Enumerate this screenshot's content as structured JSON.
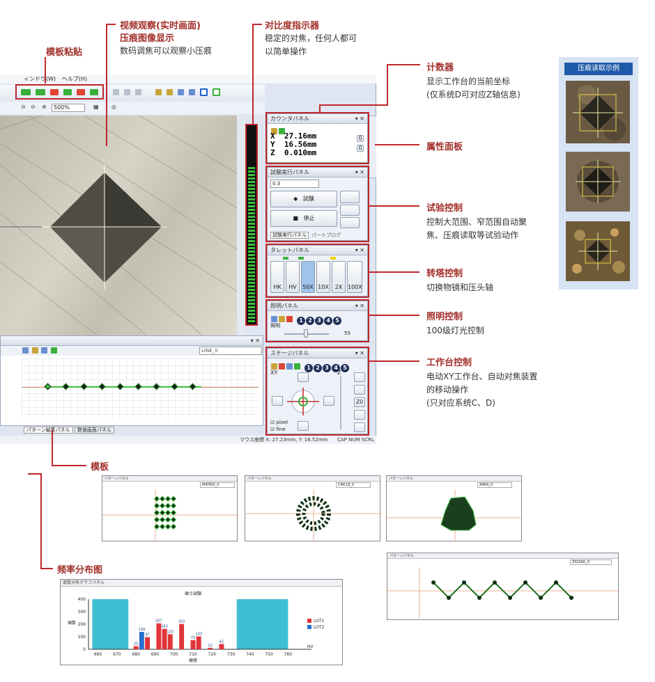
{
  "annotations": {
    "template_paste": {
      "title": "模板粘贴"
    },
    "video": {
      "title": "视频观察(实时画面)",
      "subtitle": "压痕图像显示",
      "desc": "数码调焦可以观察小压痕"
    },
    "contrast": {
      "title": "对比度指示器",
      "desc_l1": "稳定的对焦，任何人都可",
      "desc_l2": "以简单操作"
    },
    "counter": {
      "title": "计数器",
      "desc_l1": "显示工作台的当前坐标",
      "desc_l2": "(仅系统D可对应Z轴信息)"
    },
    "property": {
      "title": "属性面板"
    },
    "test_control": {
      "title": "试验控制",
      "desc_l1": "控制大范围、窄范围自动聚",
      "desc_l2": "焦、压痕读取等试验动作"
    },
    "turret_control": {
      "title": "转塔控制",
      "desc": "切换物镜和压头轴"
    },
    "light_control": {
      "title": "照明控制",
      "desc": "100级灯光控制"
    },
    "stage_control": {
      "title": "工作台控制",
      "desc_l1": "电动XY工作台、自动对焦装置",
      "desc_l2": "的移动操作",
      "desc_l3": "(只对应系统C、D)"
    },
    "template": {
      "title": "模板"
    },
    "freq": {
      "title": "频率分布图"
    }
  },
  "example": {
    "title": "压痕读取示例"
  },
  "menu": {
    "window": "ィンドウ(W)",
    "help": "ヘルプ(H)",
    "zoom": "500%"
  },
  "counter_panel": {
    "title": "カウンタパネル",
    "x_label": "X",
    "x_value": "27.16mm",
    "y_label": "Y",
    "y_value": "16.56mm",
    "z_label": "Z",
    "z_value": "0.010mm"
  },
  "test_panel": {
    "title": "試験実行パネル",
    "value": "0.3",
    "test_btn": "試験",
    "stop_btn": "停止",
    "tab1": "試験実行パネル",
    "tab2": "パートプログ"
  },
  "turret_panel": {
    "title": "タレットパネル",
    "items": [
      "HK",
      "HV",
      "50X",
      "10X",
      "2X",
      "100X"
    ]
  },
  "light_panel": {
    "title": "照明パネル",
    "label": "照明",
    "value": "55",
    "nums": [
      "1",
      "2",
      "3",
      "4",
      "5"
    ]
  },
  "stage_panel": {
    "title": "ステージパネル",
    "xy": "XY",
    "z": "Z",
    "z0": "Z0",
    "pixel": "pixel",
    "fine": "fine",
    "nums": [
      "1",
      "2",
      "3",
      "4",
      "5"
    ]
  },
  "pattern_panel": {
    "line_select": "LINE_0",
    "tab1": "パターン編集パネル",
    "tab2": "数値画面パネル"
  },
  "status": {
    "mouse": "マウス座標 X: 27.23mm, Y: 16.52mm",
    "caps": "CAP NUM SCRL"
  },
  "minis": [
    {
      "title": "パターンパネル",
      "select": "MATRIX_0"
    },
    {
      "title": "パターンパネル",
      "select": "CIRCLE_0"
    },
    {
      "title": "パターンパネル",
      "select": "AREA_0"
    },
    {
      "title": "パターンパネル",
      "select": "ZIGZAG_0"
    }
  ],
  "chart_panel": {
    "title": "度数分布グラフパネル"
  },
  "chart_data": {
    "type": "bar",
    "title": "硬さ試験",
    "xlabel": "硬度",
    "ylabel": "個数",
    "unit": "HV",
    "x_ticks": [
      "660",
      "670",
      "680",
      "690",
      "700",
      "710",
      "720",
      "730",
      "740",
      "750",
      "760"
    ],
    "y_ticks": [
      "0",
      "100",
      "200",
      "300",
      "400"
    ],
    "ylim": [
      0,
      400
    ],
    "categories": [
      "680",
      "683",
      "686",
      "689",
      "692",
      "695",
      "698",
      "701",
      "704",
      "707",
      "710",
      "713",
      "716",
      "719",
      "722",
      "725",
      "728"
    ],
    "series": [
      {
        "name": "LOT1",
        "color": "#e0343a",
        "values": [
          25,
          0,
          97,
          0,
          207,
          163,
          120,
          0,
          202,
          0,
          73,
          103,
          0,
          12,
          0,
          42,
          0
        ]
      },
      {
        "name": "LOT2",
        "color": "#2a6fd0",
        "values": [
          0,
          139,
          0,
          0,
          0,
          0,
          0,
          0,
          0,
          0,
          0,
          0,
          0,
          0,
          0,
          0,
          0
        ]
      }
    ],
    "value_labels": [
      "25",
      "139",
      "97",
      "207",
      "163",
      "120",
      "202",
      "73",
      "103",
      "12",
      "42"
    ],
    "legend": "right"
  }
}
